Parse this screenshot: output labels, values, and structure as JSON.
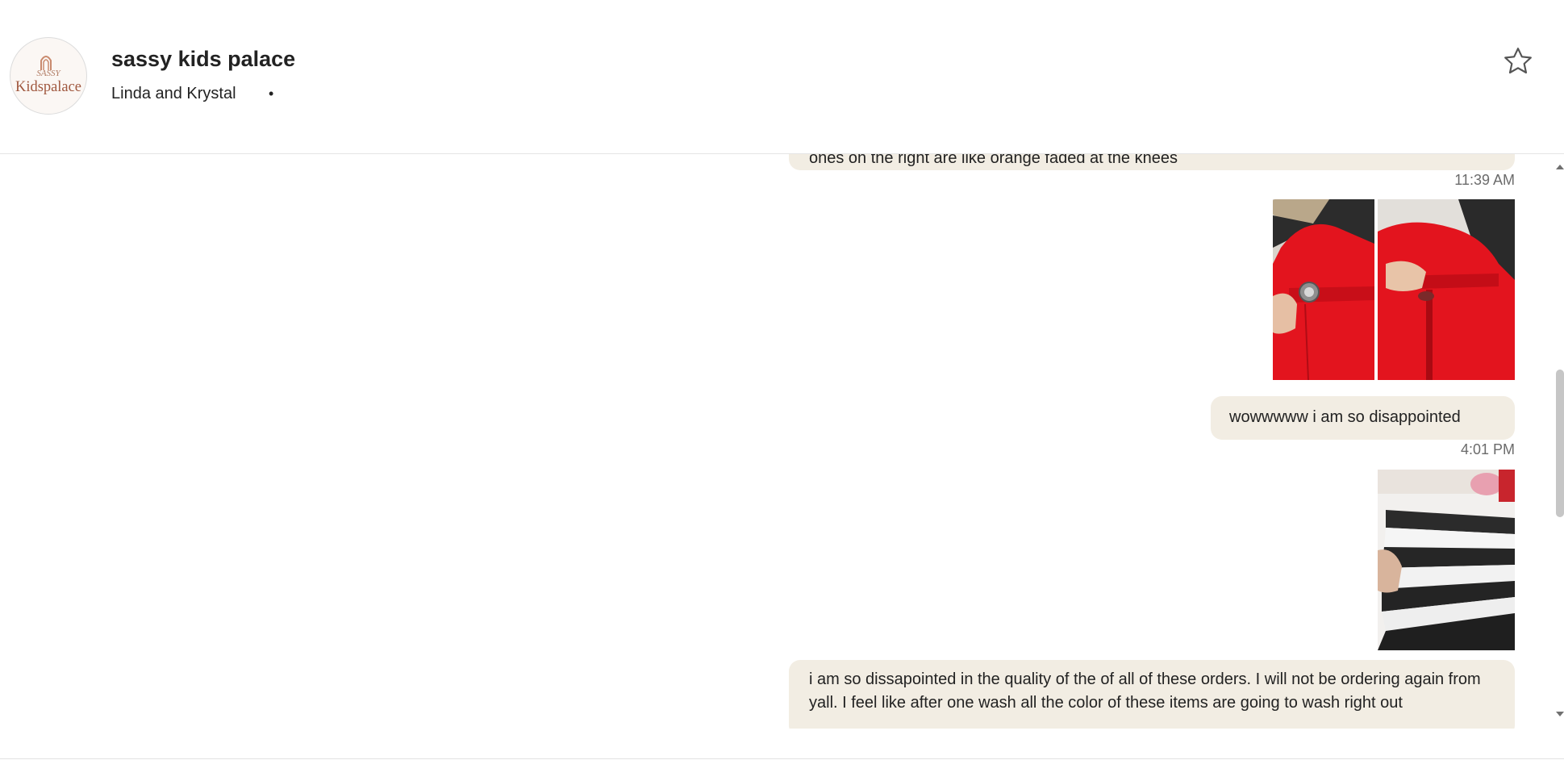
{
  "header": {
    "shop_name": "sassy kids palace",
    "owners": "Linda and Krystal",
    "separator": "•",
    "logo_text_top": "SASSY",
    "logo_text_main": "Kidspalace",
    "favorite_icon": "star-outline-icon"
  },
  "messages": [
    {
      "id": "msg-top",
      "type": "text",
      "text": "ones on the right are like orange faded at the knees",
      "timestamp": "11:39 AM"
    },
    {
      "id": "msg-images-red",
      "type": "images",
      "images": [
        "red-shorts-button-photo",
        "red-shorts-zipper-photo"
      ]
    },
    {
      "id": "msg-disappointed",
      "type": "text",
      "text": "wowwwww i am so disappointed",
      "timestamp": "4:01 PM"
    },
    {
      "id": "msg-images-striped",
      "type": "images",
      "images": [
        "black-white-striped-fabric-photo"
      ]
    },
    {
      "id": "msg-quality",
      "type": "text",
      "text": "i am so dissapointed in the quality of the of all of these orders. I will not be ordering again from yall. I feel like after one wash all the color of these items are going to wash right out"
    }
  ],
  "colors": {
    "bubble_bg": "#f2ede3",
    "timestamp": "#6b6b6b",
    "text": "#222222",
    "logo_brown": "#a0583f"
  }
}
